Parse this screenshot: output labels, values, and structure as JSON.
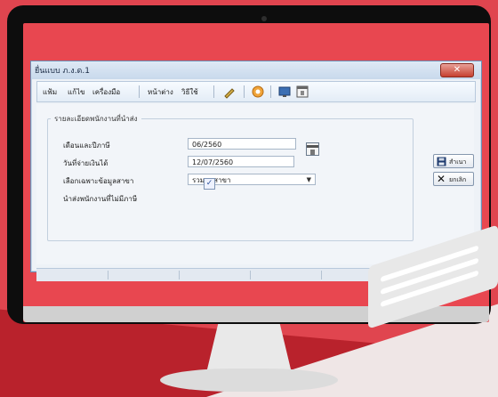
{
  "window": {
    "title": "ยื่นแบบ ภ.ง.ด.1"
  },
  "menu": {
    "items": [
      "แฟ้ม",
      "แก้ไข",
      "เครื่องมือ",
      "หน้าต่าง",
      "วิธีใช้"
    ]
  },
  "toolbar": {
    "icons": [
      "pencil-icon",
      "gear-icon",
      "monitor-icon",
      "calendar-icon"
    ]
  },
  "form": {
    "group_title": "รายละเอียดพนักงานที่นำส่ง",
    "month_year_label": "เดือนและปีภาษี",
    "month_year_value": "06/2560",
    "pay_date_label": "วันที่จ่ายเงินได้",
    "pay_date_value": "12/07/2560",
    "branch_label": "เลือกเฉพาะข้อมูลสาขา",
    "branch_value": "รวมทุกสาขา",
    "include_no_tax_label": "นำส่งพนักงานที่ไม่มีภาษี",
    "include_no_tax_checked": true
  },
  "buttons": {
    "save": "สำเนา",
    "cancel": "ยกเลิก"
  },
  "colors": {
    "background": "#e0454f",
    "accent_dark": "#b9222c",
    "window_border": "#6d8fb5"
  }
}
